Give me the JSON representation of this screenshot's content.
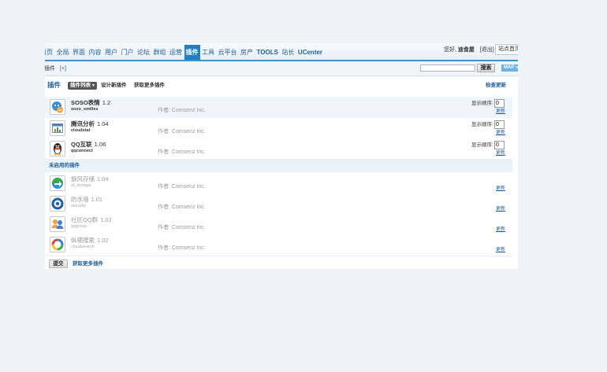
{
  "nav": {
    "items": [
      "首页",
      "全局",
      "界面",
      "内容",
      "用户",
      "门户",
      "论坛",
      "群组",
      "运营",
      "插件",
      "工具",
      "云平台",
      "房产",
      "TOOLS",
      "站长",
      "UCenter"
    ],
    "active": "插件"
  },
  "user": {
    "greeting": "您好,",
    "name": "迪食屋",
    "logout": "[退出]",
    "site_home": "站点首页"
  },
  "subbar": {
    "title": "插件",
    "add": "[+]",
    "search_value": "",
    "search_button": "搜索",
    "map_button": "MAP »"
  },
  "panel": {
    "title": "插件",
    "tab_active": "插件列表",
    "tab_design": "设计新插件",
    "tab_more": "获取更多插件",
    "check_update": "检查更新"
  },
  "labels": {
    "order": "显示顺序:",
    "update": "更新"
  },
  "enabled": [
    {
      "name": "SOSO表情",
      "version": "1.2",
      "id": "soso_smilies",
      "author": "作者: Comsenz Inc.",
      "order": "0",
      "icon": "soso-smiley-icon"
    },
    {
      "name": "腾讯分析",
      "version": "1.04",
      "id": "cloudstat",
      "author": "作者: Comsenz Inc.",
      "order": "0",
      "icon": "analytics-chart-icon"
    },
    {
      "name": "QQ互联",
      "version": "1.06",
      "id": "qqconnect",
      "author": "作者: Comsenz Inc.",
      "order": "0",
      "icon": "qq-penguin-icon"
    }
  ],
  "disabled_header": "未启用的插件",
  "disabled": [
    {
      "name": "旋风存储",
      "version": "1.04",
      "id": "xf_storage",
      "author": "作者: Comsenz Inc.",
      "icon": "storage-arrow-icon"
    },
    {
      "name": "防水墙",
      "version": "1.01",
      "id": "security",
      "author": "作者: Comsenz Inc.",
      "icon": "security-ring-icon"
    },
    {
      "name": "社区QQ群",
      "version": "1.02",
      "id": "qqgroup",
      "author": "作者: Comsenz Inc.",
      "icon": "qq-group-icon"
    },
    {
      "name": "纵横搜索",
      "version": "1.02",
      "id": "cloudsearch",
      "author": "作者: Comsenz Inc.",
      "icon": "cloud-search-icon"
    }
  ],
  "footer": {
    "submit": "提交",
    "more": "获取更多插件"
  },
  "colors": {
    "accent": "#1e7fc3",
    "link": "#1f5f9f",
    "topline": "#3b93d1",
    "muted": "#9a9a9a"
  }
}
